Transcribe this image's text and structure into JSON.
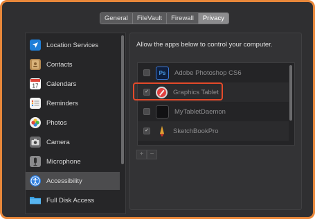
{
  "tabs": [
    "General",
    "FileVault",
    "Firewall",
    "Privacy"
  ],
  "active_tab": "Privacy",
  "sidebar": {
    "items": [
      {
        "label": "Location Services",
        "icon": "location-arrow-icon"
      },
      {
        "label": "Contacts",
        "icon": "contacts-book-icon"
      },
      {
        "label": "Calendars",
        "icon": "calendar-icon"
      },
      {
        "label": "Reminders",
        "icon": "reminders-list-icon"
      },
      {
        "label": "Photos",
        "icon": "photos-flower-icon"
      },
      {
        "label": "Camera",
        "icon": "camera-icon"
      },
      {
        "label": "Microphone",
        "icon": "microphone-icon"
      },
      {
        "label": "Accessibility",
        "icon": "accessibility-icon"
      },
      {
        "label": "Full Disk Access",
        "icon": "folder-icon"
      }
    ],
    "selected": "Accessibility"
  },
  "main": {
    "instruction": "Allow the apps below to control your computer.",
    "apps": [
      {
        "label": "Adobe Photoshop CS6",
        "checked": false,
        "icon": "photoshop-icon",
        "icon_text": "Ps"
      },
      {
        "label": "Graphics Tablet",
        "checked": true,
        "icon": "graphics-tablet-icon"
      },
      {
        "label": "MyTabletDaemon",
        "checked": false,
        "icon": "terminal-icon"
      },
      {
        "label": "SketchBookPro",
        "checked": true,
        "icon": "pencil-icon"
      }
    ],
    "add_label": "+",
    "remove_label": "−",
    "highlighted_app": "Graphics Tablet"
  },
  "colors": {
    "highlight": "#e54a2a",
    "window_border": "#e8873a",
    "selection": "#4c4c4e"
  }
}
